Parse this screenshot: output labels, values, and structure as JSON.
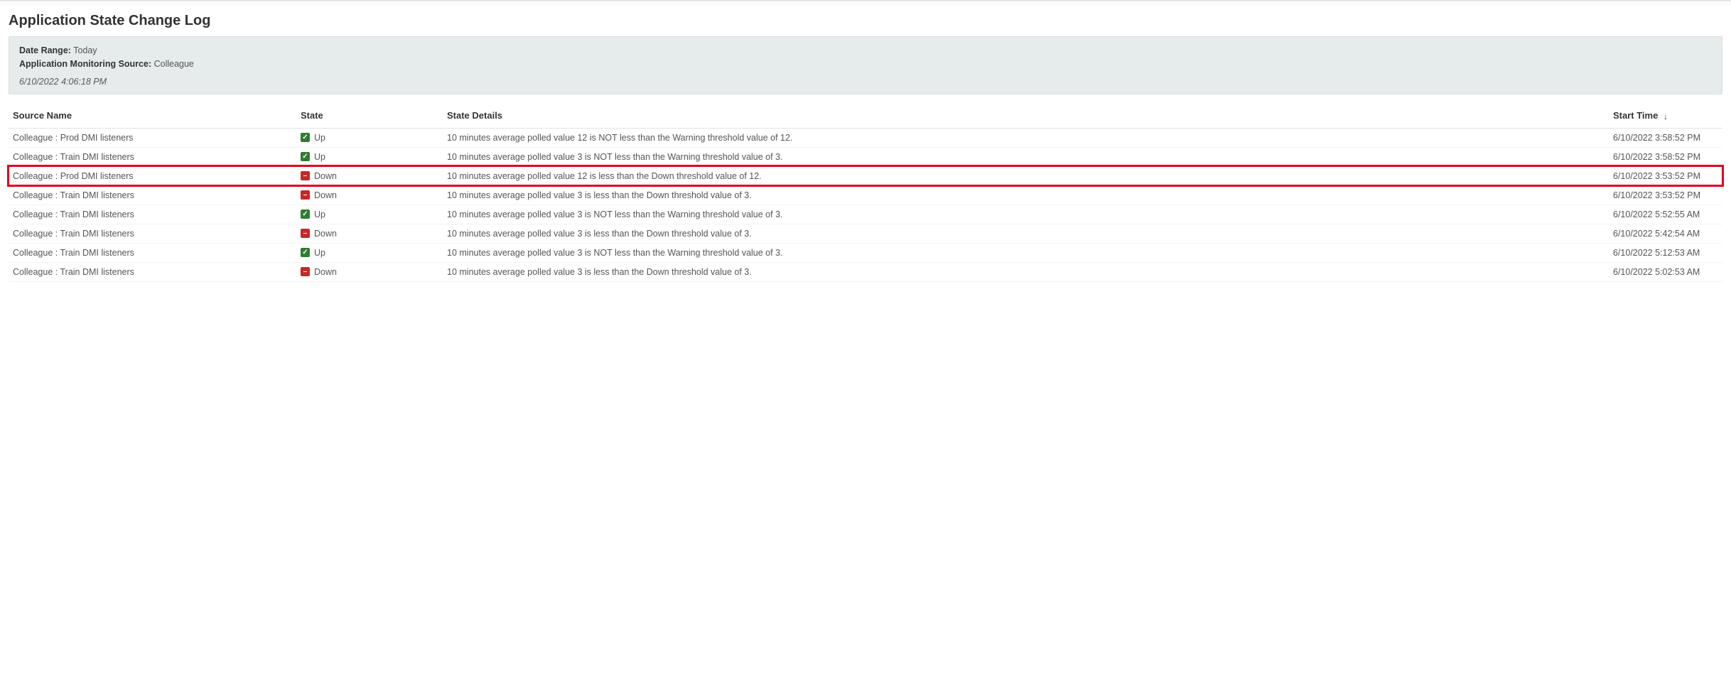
{
  "title": "Application State Change Log",
  "filters": {
    "date_range_label": "Date Range:",
    "date_range_value": "Today",
    "source_label": "Application Monitoring Source:",
    "source_value": "Colleague",
    "timestamp": "6/10/2022 4:06:18 PM"
  },
  "columns": {
    "source": "Source Name",
    "state": "State",
    "details": "State Details",
    "start": "Start Time"
  },
  "sort_indicator": "↓",
  "state_labels": {
    "up": "Up",
    "down": "Down"
  },
  "rows": [
    {
      "source": "Colleague : Prod DMI listeners",
      "state": "up",
      "details": "10 minutes average polled value 12 is NOT less than the Warning threshold value of 12.",
      "start": "6/10/2022 3:58:52 PM",
      "highlight": false
    },
    {
      "source": "Colleague : Train DMI listeners",
      "state": "up",
      "details": "10 minutes average polled value 3 is NOT less than the Warning threshold value of 3.",
      "start": "6/10/2022 3:58:52 PM",
      "highlight": false
    },
    {
      "source": "Colleague : Prod DMI listeners",
      "state": "down",
      "details": "10 minutes average polled value 12 is less than the Down threshold value of 12.",
      "start": "6/10/2022 3:53:52 PM",
      "highlight": true
    },
    {
      "source": "Colleague : Train DMI listeners",
      "state": "down",
      "details": "10 minutes average polled value 3 is less than the Down threshold value of 3.",
      "start": "6/10/2022 3:53:52 PM",
      "highlight": false
    },
    {
      "source": "Colleague : Train DMI listeners",
      "state": "up",
      "details": "10 minutes average polled value 3 is NOT less than the Warning threshold value of 3.",
      "start": "6/10/2022 5:52:55 AM",
      "highlight": false
    },
    {
      "source": "Colleague : Train DMI listeners",
      "state": "down",
      "details": "10 minutes average polled value 3 is less than the Down threshold value of 3.",
      "start": "6/10/2022 5:42:54 AM",
      "highlight": false
    },
    {
      "source": "Colleague : Train DMI listeners",
      "state": "up",
      "details": "10 minutes average polled value 3 is NOT less than the Warning threshold value of 3.",
      "start": "6/10/2022 5:12:53 AM",
      "highlight": false
    },
    {
      "source": "Colleague : Train DMI listeners",
      "state": "down",
      "details": "10 minutes average polled value 3 is less than the Down threshold value of 3.",
      "start": "6/10/2022 5:02:53 AM",
      "highlight": false
    }
  ]
}
